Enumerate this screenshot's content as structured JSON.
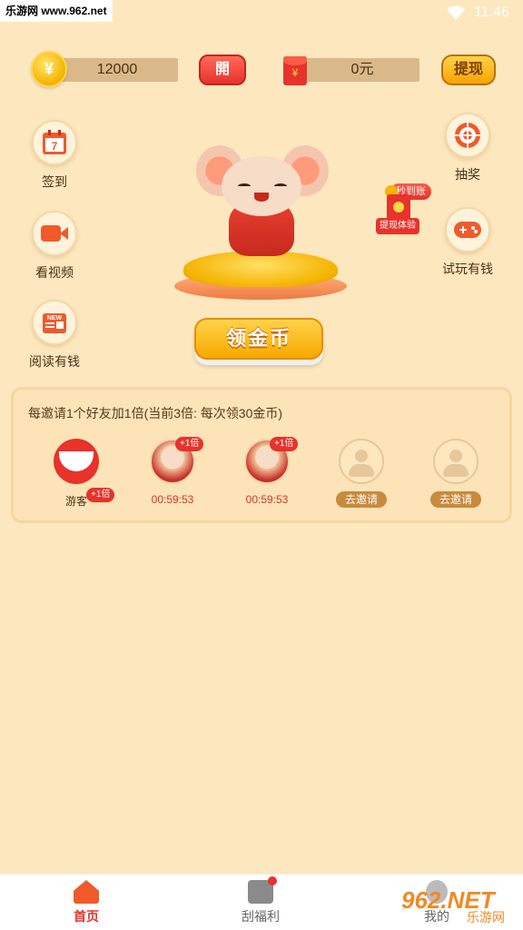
{
  "status_bar": {
    "site": "乐游网 www.962.net",
    "time": "11:46"
  },
  "balance": {
    "coin_symbol": "¥",
    "coins": "12000",
    "open_label": "開",
    "cash_symbol": "¥",
    "cash": "0元",
    "withdraw_label": "提现"
  },
  "left_menu": [
    {
      "label": "签到",
      "icon": "calendar-icon",
      "icon_text": "7"
    },
    {
      "label": "看视频",
      "icon": "video-icon"
    },
    {
      "label": "阅读有钱",
      "icon": "news-icon",
      "icon_text": "NEW"
    }
  ],
  "right_menu": [
    {
      "label": "抽奖",
      "icon": "lottery-wheel-icon"
    },
    {
      "label": "试玩有钱",
      "icon": "gamepad-icon"
    }
  ],
  "promo_badge": {
    "pill": "秒到账",
    "label": "提现体验",
    "env_text": "领"
  },
  "collect_button": "领金币",
  "invite": {
    "title": "每邀请1个好友加1倍(当前3倍: 每次领30金币)",
    "slots": [
      {
        "type": "guest",
        "tag": "+1倍",
        "label": "游客"
      },
      {
        "type": "friend",
        "tag": "+1倍",
        "timer": "00:59:53"
      },
      {
        "type": "friend",
        "tag": "+1倍",
        "timer": "00:59:53"
      },
      {
        "type": "empty",
        "button": "去邀请"
      },
      {
        "type": "empty",
        "button": "去邀请"
      }
    ]
  },
  "bottom_nav": [
    {
      "label": "首页",
      "active": true
    },
    {
      "label": "刮福利",
      "active": false
    },
    {
      "label": "我的",
      "active": false
    }
  ],
  "watermark": {
    "text": "962.NET",
    "sub": "乐游网"
  },
  "colors": {
    "background": "#fde7bf",
    "accent_red": "#e8322a",
    "accent_gold": "#f5b300",
    "nav_active": "#e8322a"
  }
}
